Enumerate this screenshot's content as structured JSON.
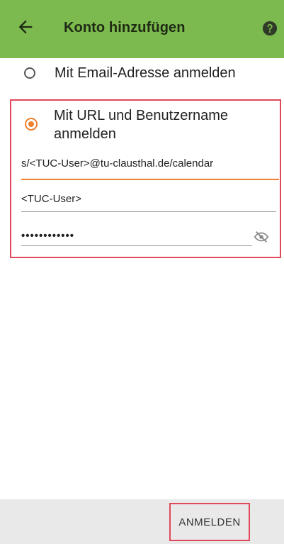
{
  "header": {
    "title": "Konto hinzufügen",
    "back_icon": "arrow-left-icon",
    "help_icon": "help-circle-icon",
    "bg_color": "#7cba4f"
  },
  "options": {
    "email": {
      "label": "Mit Email-Adresse anmelden",
      "selected": false
    },
    "url": {
      "label": "Mit URL und Benutzername anmelden",
      "selected": true
    }
  },
  "form": {
    "url_value": "s/<TUC-User>@tu-clausthal.de/calendar",
    "username_value": "<TUC-User>",
    "password_mask": "••••••••••••",
    "visibility_icon": "eye-off-icon"
  },
  "footer": {
    "login_label": "ANMELDEN"
  },
  "colors": {
    "accent": "#f07f2e",
    "highlight_frame": "#e0495a"
  }
}
